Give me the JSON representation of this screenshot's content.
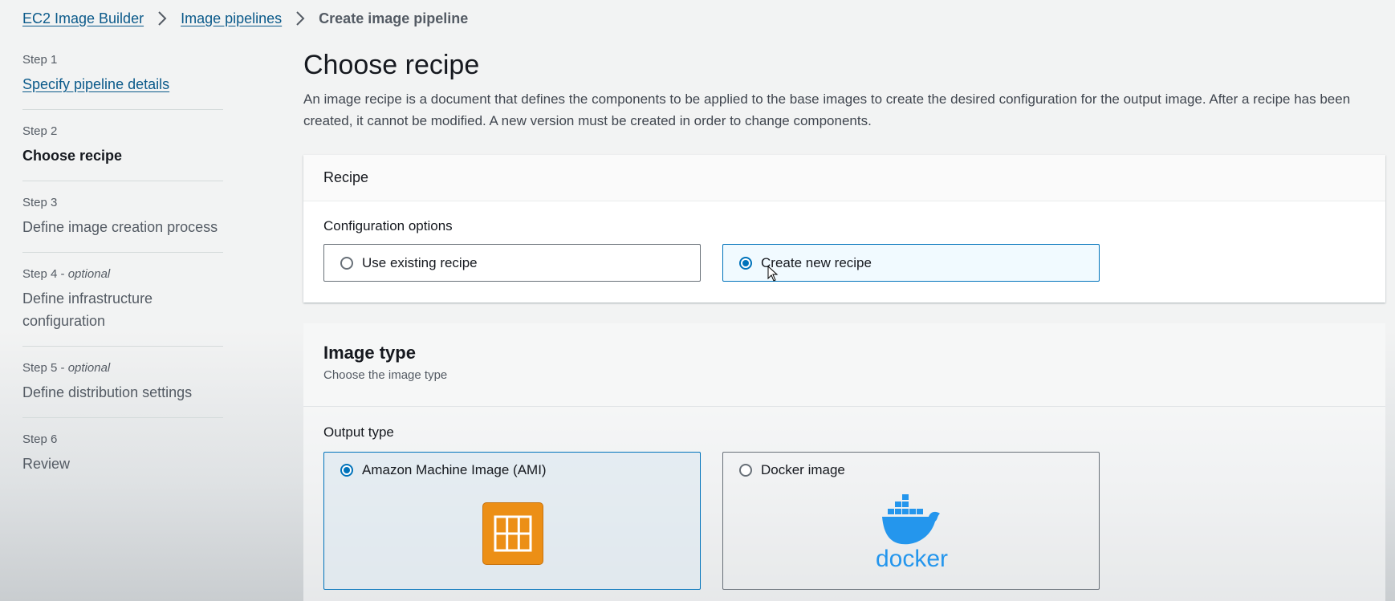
{
  "breadcrumb": {
    "items": [
      "EC2 Image Builder",
      "Image pipelines"
    ],
    "current": "Create image pipeline"
  },
  "steps": [
    {
      "num": "Step 1",
      "optional": "",
      "title": "Specify pipeline details",
      "state": "link"
    },
    {
      "num": "Step 2",
      "optional": "",
      "title": "Choose recipe",
      "state": "active"
    },
    {
      "num": "Step 3",
      "optional": "",
      "title": "Define image creation process",
      "state": "normal"
    },
    {
      "num": "Step 4 - ",
      "optional": "optional",
      "title": "Define infrastructure configuration",
      "state": "normal"
    },
    {
      "num": "Step 5 - ",
      "optional": "optional",
      "title": "Define distribution settings",
      "state": "normal"
    },
    {
      "num": "Step 6",
      "optional": "",
      "title": "Review",
      "state": "normal"
    }
  ],
  "page": {
    "title": "Choose recipe",
    "description": "An image recipe is a document that defines the components to be applied to the base images to create the desired configuration for the output image. After a recipe has been created, it cannot be modified. A new version must be created in order to change components."
  },
  "recipe": {
    "header": "Recipe",
    "config_label": "Configuration options",
    "options": [
      {
        "label": "Use existing recipe",
        "selected": false
      },
      {
        "label": "Create new recipe",
        "selected": true
      }
    ]
  },
  "image_type": {
    "title": "Image type",
    "subtitle": "Choose the image type",
    "output_label": "Output type",
    "options": [
      {
        "label": "Amazon Machine Image (AMI)",
        "selected": true,
        "icon": "ami-icon"
      },
      {
        "label": "Docker image",
        "selected": false,
        "icon": "docker-logo",
        "logo_text": "docker"
      }
    ]
  },
  "colors": {
    "link": "#0b5a8a",
    "selected": "#0073bb",
    "ami_orange": "#ec8f16",
    "docker_blue": "#2496ed"
  }
}
